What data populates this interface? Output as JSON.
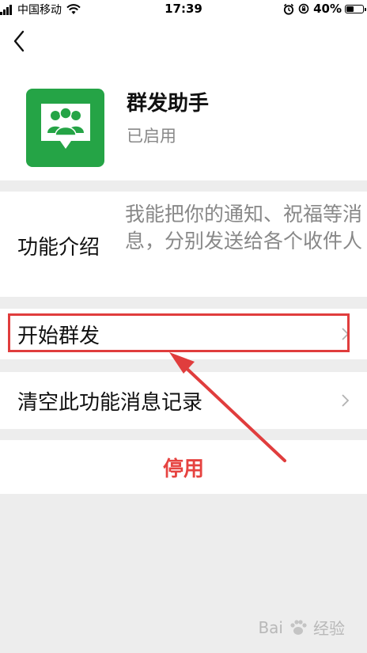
{
  "status_bar": {
    "carrier": "中国移动",
    "time": "17:39",
    "battery": "40%"
  },
  "header": {
    "app_name": "群发助手",
    "app_status": "已启用"
  },
  "intro": {
    "label": "功能介绍",
    "description": "我能把你的通知、祝福等消息，分别发送给各个收件人"
  },
  "rows": {
    "start": "开始群发",
    "clear": "清空此功能消息记录",
    "disable": "停用"
  },
  "watermark": {
    "left": "Bai",
    "right": "经验"
  },
  "colors": {
    "icon_green": "#25a446",
    "disable_red": "#e64340",
    "highlight_red": "#e03d3d"
  }
}
